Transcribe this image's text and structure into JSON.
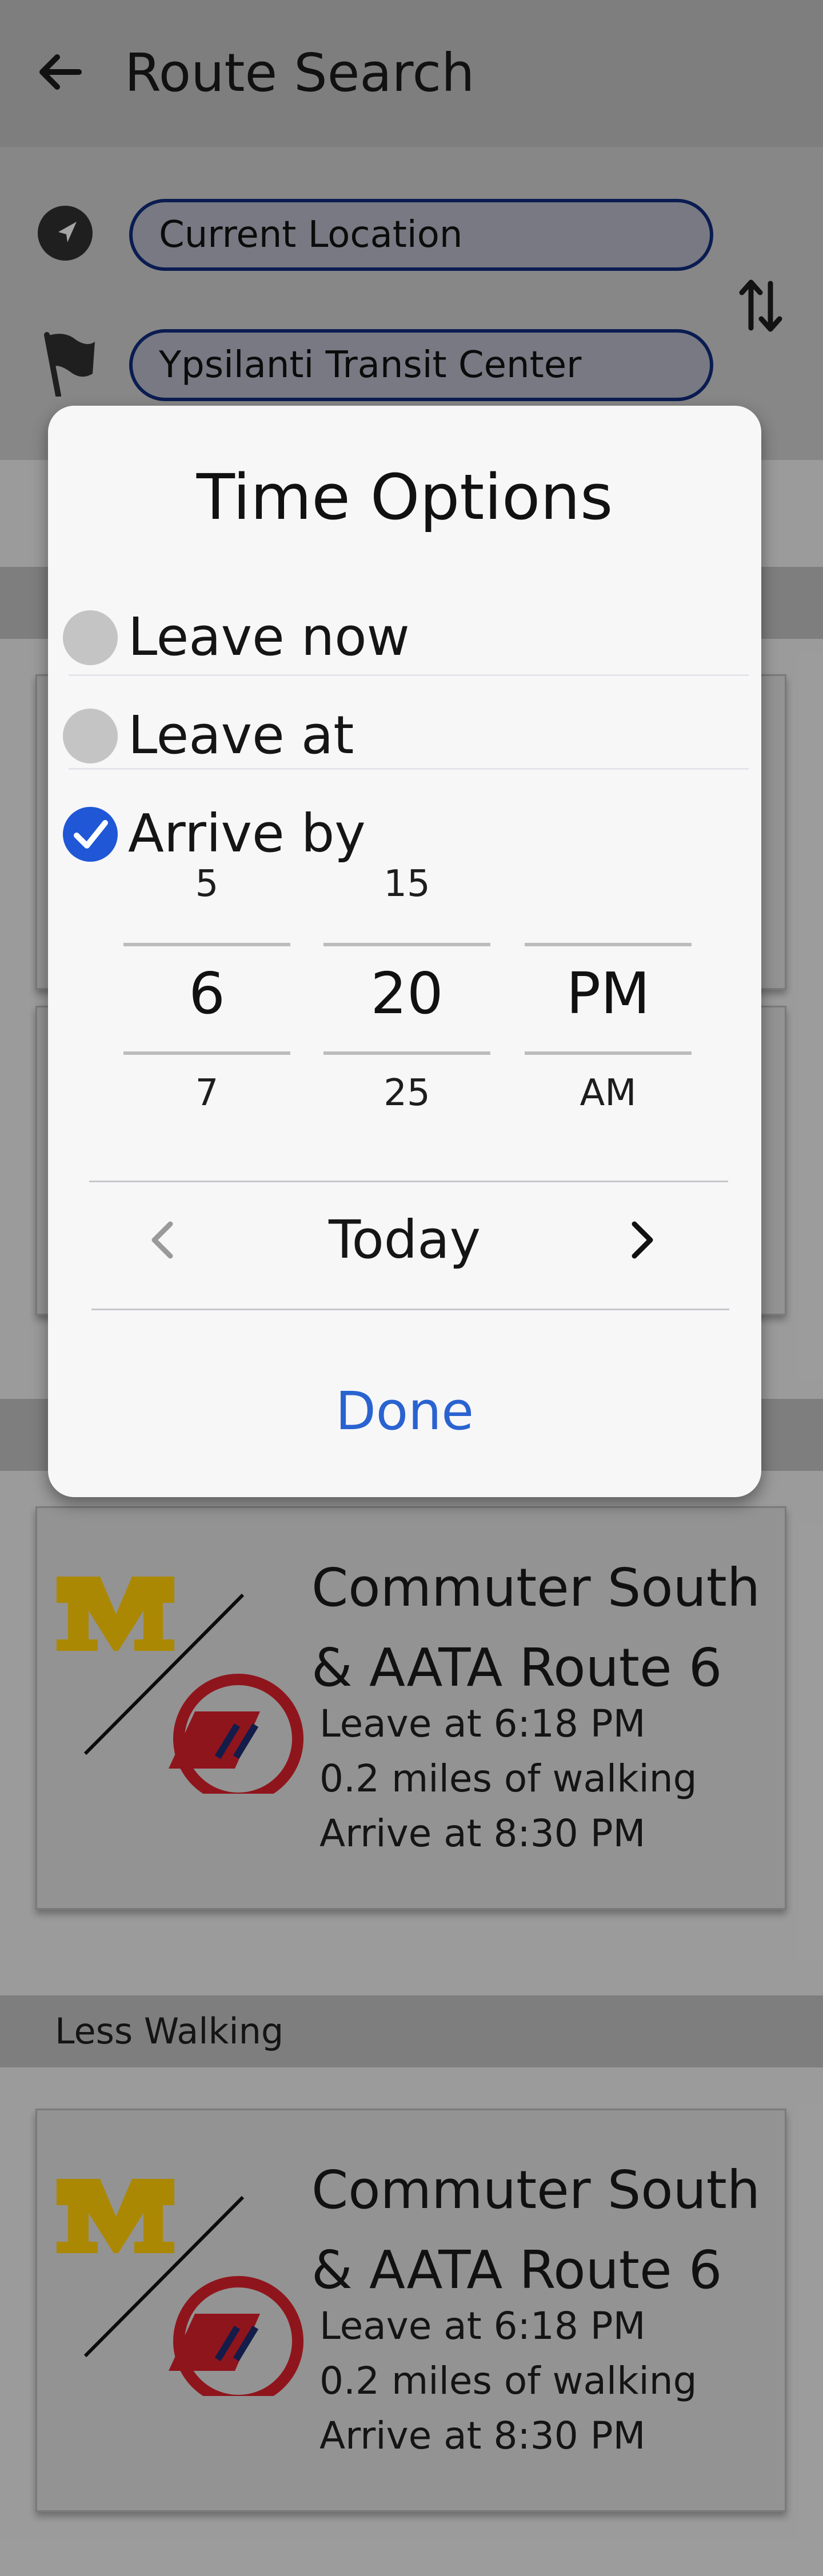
{
  "header": {
    "title": "Route Search",
    "back_icon": "arrow-left-icon"
  },
  "search": {
    "origin_value": "Current Location",
    "destination_value": "Ypsilanti Transit Center",
    "origin_icon": "navigation-arrow-icon",
    "destination_icon": "flag-icon",
    "swap_icon": "swap-vertical-icon"
  },
  "list": {
    "sections": [
      {
        "label": "",
        "cards": []
      },
      {
        "label": "",
        "cards": [
          {
            "route_line1": "Commuter South",
            "route_line2": "& AATA Route 6",
            "leave": "Leave at 6:18 PM",
            "walking": "0.2 miles of walking",
            "arrive": "Arrive at 8:30 PM"
          }
        ]
      },
      {
        "label": "Less Walking",
        "cards": [
          {
            "route_line1": "Commuter South",
            "route_line2": "& AATA Route 6",
            "leave": "Leave at 6:18 PM",
            "walking": "0.2 miles of walking",
            "arrive": "Arrive at 8:30 PM"
          }
        ]
      }
    ]
  },
  "dialog": {
    "title": "Time Options",
    "options": [
      {
        "label": "Leave now",
        "selected": false
      },
      {
        "label": "Leave at",
        "selected": false
      },
      {
        "label": "Arrive by",
        "selected": true
      }
    ],
    "pickers": {
      "hour": {
        "above": "5",
        "selected": "6",
        "below": "7"
      },
      "minute": {
        "above": "15",
        "selected": "20",
        "below": "25"
      },
      "period": {
        "above": "",
        "selected": "PM",
        "below": "AM"
      }
    },
    "day": "Today",
    "prev_icon": "chevron-left-icon",
    "next_icon": "chevron-right-icon",
    "done_label": "Done"
  },
  "colors": {
    "accent": "#1f57d6",
    "done_text": "#2a63d0",
    "michigan_maize": "#ffcb05",
    "aata_red": "#d6202a",
    "aata_blue": "#1e2a6e",
    "field_border": "#0f2a7a"
  }
}
